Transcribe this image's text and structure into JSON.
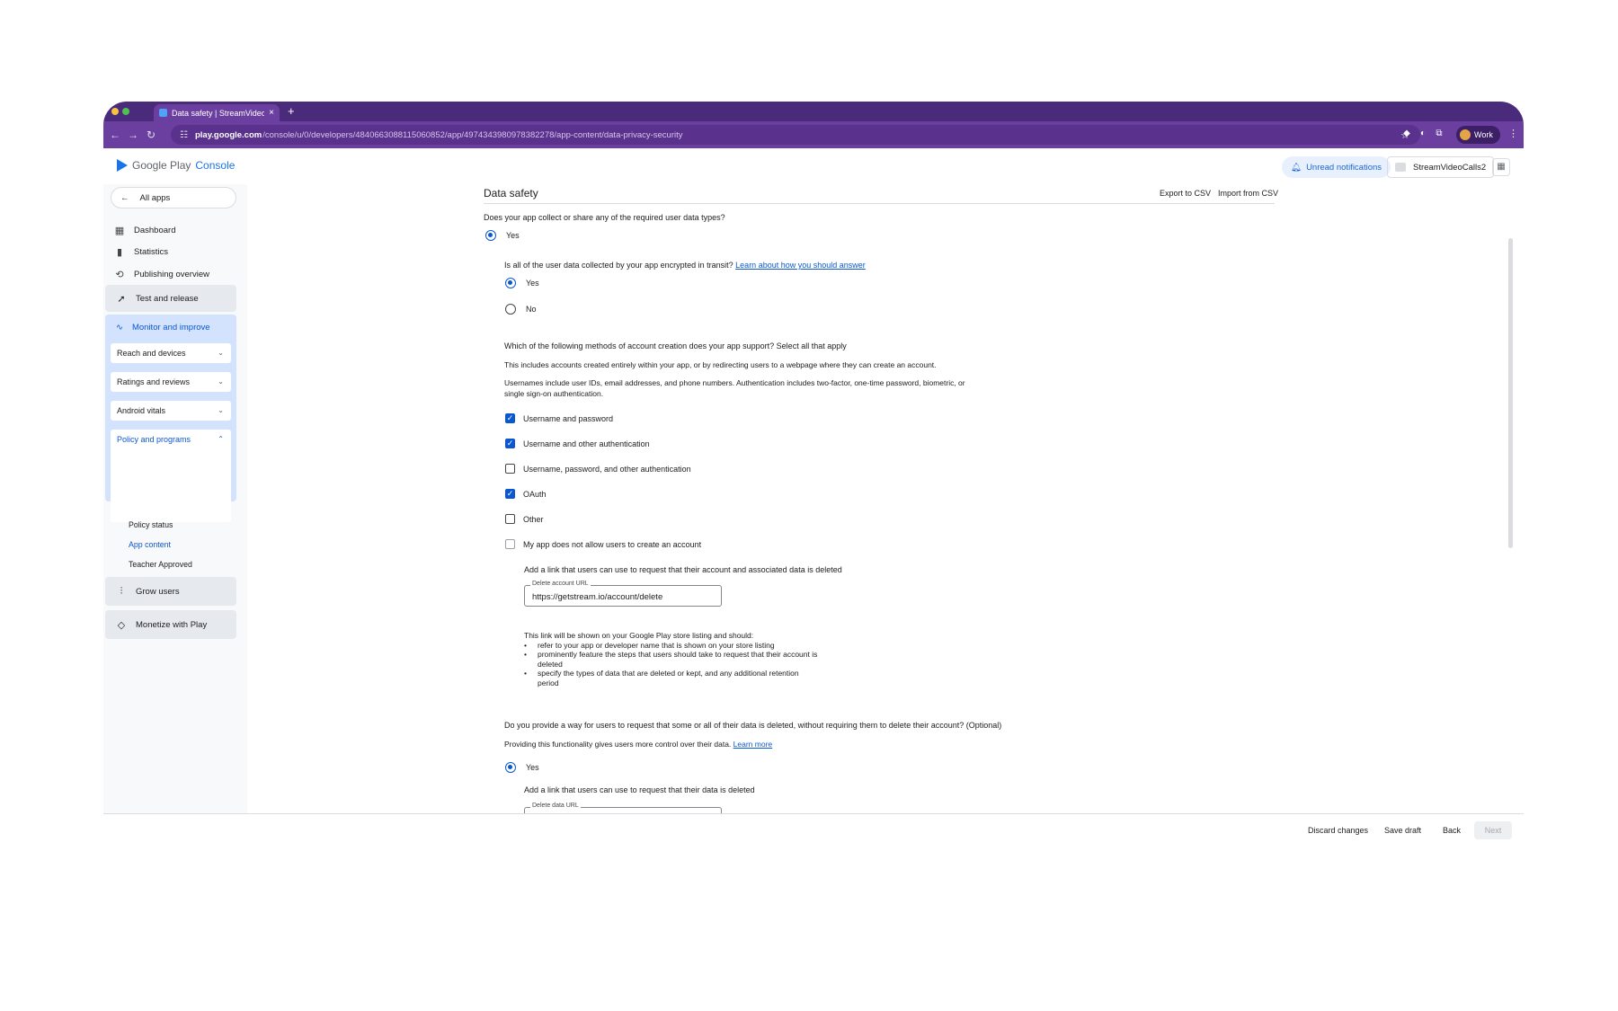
{
  "browser": {
    "tab_title": "Data safety | StreamVideoCal",
    "new_tab": "+",
    "url_host": "play.google.com",
    "url_path": "/console/u/0/developers/4840663088115060852/app/4974343980978382278/app-content/data-privacy-security",
    "profile_label": "Work"
  },
  "header": {
    "logo_google_play": "Google Play",
    "logo_console": "Console",
    "unread_notifications": "Unread notifications",
    "account_name": "StreamVideoCalls2"
  },
  "sidebar": {
    "all_apps": "All apps",
    "items": [
      {
        "label": "Dashboard",
        "icon": "dashboard-icon"
      },
      {
        "label": "Statistics",
        "icon": "bar-chart-icon"
      },
      {
        "label": "Publishing overview",
        "icon": "publishing-icon"
      }
    ],
    "test_and_release": "Test and release",
    "monitor_and_improve": "Monitor and improve",
    "reach_and_devices": "Reach and devices",
    "ratings_and_reviews": "Ratings and reviews",
    "android_vitals": "Android vitals",
    "policy_and_programs": "Policy and programs",
    "policy_status": "Policy status",
    "app_content": "App content",
    "teacher_approved": "Teacher Approved",
    "grow_users": "Grow users",
    "monetize_with_play": "Monetize with Play"
  },
  "main": {
    "title": "Data safety",
    "export_csv": "Export to CSV",
    "import_csv": "Import from CSV",
    "q1": "Does your app collect or share any of the required user data types?",
    "q1_yes": "Yes",
    "q2": "Is all of the user data collected by your app encrypted in transit?",
    "q2_link": "Learn about how you should answer",
    "q2_yes": "Yes",
    "q2_no": "No",
    "q3": "Which of the following methods of account creation does your app support? Select all that apply",
    "q3_desc1": "This includes accounts created entirely within your app, or by redirecting users to a webpage where they can create an account.",
    "q3_desc2a": "Usernames include user IDs, email addresses, and phone numbers. Authentication includes two-factor, one-time password, biometric, or",
    "q3_desc2b": "single sign-on authentication.",
    "options": [
      {
        "label": "Username and password",
        "checked": true
      },
      {
        "label": "Username and other authentication",
        "checked": true
      },
      {
        "label": "Username, password, and other authentication",
        "checked": false
      },
      {
        "label": "OAuth",
        "checked": true
      },
      {
        "label": "Other",
        "checked": false
      },
      {
        "label": "My app does not allow users to create an account",
        "checked": false
      }
    ],
    "delete_account_prompt": "Add a link that users can use to request that their account and associated data is deleted",
    "delete_account_label": "Delete account URL",
    "delete_account_value": "https://getstream.io/account/delete",
    "link_info_intro": "This link will be shown on your Google Play store listing and should:",
    "link_info_bullets": [
      "refer to your app or developer name that is shown on your store listing",
      "prominently feature the steps that users should take to request that their account is deleted",
      "specify the types of data that are deleted or kept, and any additional retention period"
    ],
    "q4": "Do you provide a way for users to request that some or all of their data is deleted, without requiring them to delete their account? (Optional)",
    "q4_desc": "Providing this functionality gives users more control over their data.",
    "q4_link": "Learn more",
    "q4_yes": "Yes",
    "delete_data_prompt": "Add a link that users can use to request that their data is deleted",
    "delete_data_label": "Delete data URL"
  },
  "footer": {
    "discard": "Discard changes",
    "save_draft": "Save draft",
    "back": "Back",
    "next": "Next"
  }
}
